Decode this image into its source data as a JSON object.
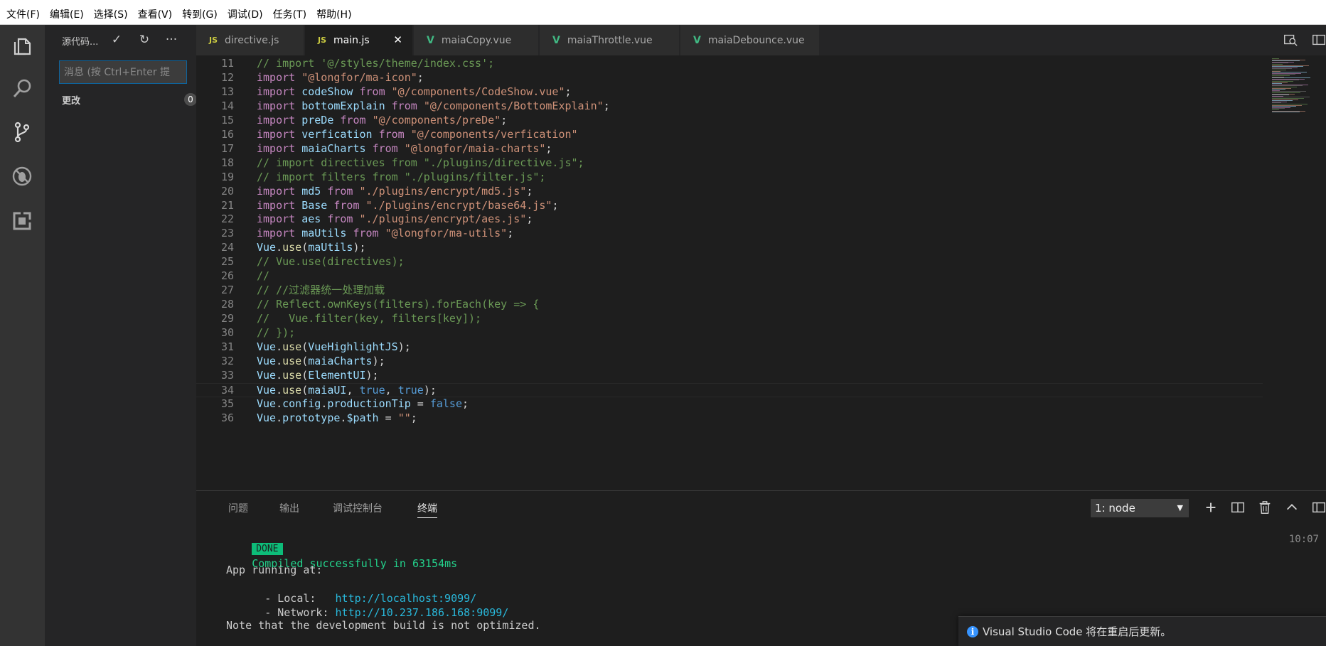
{
  "menubar": {
    "items": [
      "文件(F)",
      "编辑(E)",
      "选择(S)",
      "查看(V)",
      "转到(G)",
      "调试(D)",
      "任务(T)",
      "帮助(H)"
    ]
  },
  "activitybar": {
    "icons": [
      "explorer-icon",
      "search-icon",
      "source-control-icon",
      "debug-icon",
      "extensions-icon"
    ]
  },
  "sidebar": {
    "title": "源代码...",
    "commit_placeholder": "消息 (按 Ctrl+Enter 提",
    "changes_label": "更改",
    "changes_count": "0"
  },
  "tabs": [
    {
      "label": "directive.js",
      "type": "js",
      "icon_text": "JS",
      "active": false
    },
    {
      "label": "main.js",
      "type": "js",
      "icon_text": "JS",
      "active": true
    },
    {
      "label": "maiaCopy.vue",
      "type": "vue",
      "icon_text": "V",
      "active": false
    },
    {
      "label": "maiaThrottle.vue",
      "type": "vue",
      "icon_text": "V",
      "active": false
    },
    {
      "label": "maiaDebounce.vue",
      "type": "vue",
      "icon_text": "V",
      "active": false
    }
  ],
  "editor": {
    "lines": [
      {
        "n": "11",
        "tokens": [
          [
            "com",
            "// import '@/styles/theme/index.css';"
          ]
        ]
      },
      {
        "n": "12",
        "tokens": [
          [
            "kw",
            "import "
          ],
          [
            "str",
            "\"@longfor/ma-icon\""
          ],
          [
            "plain",
            ";"
          ]
        ]
      },
      {
        "n": "13",
        "tokens": [
          [
            "kw",
            "import "
          ],
          [
            "var",
            "codeShow "
          ],
          [
            "kw",
            "from "
          ],
          [
            "str",
            "\"@/components/CodeShow.vue\""
          ],
          [
            "plain",
            ";"
          ]
        ]
      },
      {
        "n": "14",
        "tokens": [
          [
            "kw",
            "import "
          ],
          [
            "var",
            "bottomExplain "
          ],
          [
            "kw",
            "from "
          ],
          [
            "str",
            "\"@/components/BottomExplain\""
          ],
          [
            "plain",
            ";"
          ]
        ]
      },
      {
        "n": "15",
        "tokens": [
          [
            "kw",
            "import "
          ],
          [
            "var",
            "preDe "
          ],
          [
            "kw",
            "from "
          ],
          [
            "str",
            "\"@/components/preDe\""
          ],
          [
            "plain",
            ";"
          ]
        ]
      },
      {
        "n": "16",
        "tokens": [
          [
            "kw",
            "import "
          ],
          [
            "var",
            "verfication "
          ],
          [
            "kw",
            "from "
          ],
          [
            "str",
            "\"@/components/verfication\""
          ]
        ]
      },
      {
        "n": "17",
        "tokens": [
          [
            "kw",
            "import "
          ],
          [
            "var",
            "maiaCharts "
          ],
          [
            "kw",
            "from "
          ],
          [
            "str",
            "\"@longfor/maia-charts\""
          ],
          [
            "plain",
            ";"
          ]
        ]
      },
      {
        "n": "18",
        "tokens": [
          [
            "com",
            "// import directives from \"./plugins/directive.js\";"
          ]
        ]
      },
      {
        "n": "19",
        "tokens": [
          [
            "com",
            "// import filters from \"./plugins/filter.js\";"
          ]
        ]
      },
      {
        "n": "20",
        "tokens": [
          [
            "kw",
            "import "
          ],
          [
            "var",
            "md5 "
          ],
          [
            "kw",
            "from "
          ],
          [
            "str",
            "\"./plugins/encrypt/md5.js\""
          ],
          [
            "plain",
            ";"
          ]
        ]
      },
      {
        "n": "21",
        "tokens": [
          [
            "kw",
            "import "
          ],
          [
            "var",
            "Base "
          ],
          [
            "kw",
            "from "
          ],
          [
            "str",
            "\"./plugins/encrypt/base64.js\""
          ],
          [
            "plain",
            ";"
          ]
        ]
      },
      {
        "n": "22",
        "tokens": [
          [
            "kw",
            "import "
          ],
          [
            "var",
            "aes "
          ],
          [
            "kw",
            "from "
          ],
          [
            "str",
            "\"./plugins/encrypt/aes.js\""
          ],
          [
            "plain",
            ";"
          ]
        ]
      },
      {
        "n": "23",
        "tokens": [
          [
            "kw",
            "import "
          ],
          [
            "var",
            "maUtils "
          ],
          [
            "kw",
            "from "
          ],
          [
            "str",
            "\"@longfor/ma-utils\""
          ],
          [
            "plain",
            ";"
          ]
        ]
      },
      {
        "n": "24",
        "tokens": [
          [
            "var",
            "Vue"
          ],
          [
            "plain",
            "."
          ],
          [
            "fn",
            "use"
          ],
          [
            "plain",
            "("
          ],
          [
            "var",
            "maUtils"
          ],
          [
            "plain",
            ");"
          ]
        ]
      },
      {
        "n": "25",
        "tokens": [
          [
            "com",
            "// Vue.use(directives);"
          ]
        ]
      },
      {
        "n": "26",
        "tokens": [
          [
            "com",
            "//"
          ]
        ]
      },
      {
        "n": "27",
        "tokens": [
          [
            "com",
            "// //过滤器统一处理加载"
          ]
        ]
      },
      {
        "n": "28",
        "tokens": [
          [
            "com",
            "// Reflect.ownKeys(filters).forEach(key => {"
          ]
        ]
      },
      {
        "n": "29",
        "tokens": [
          [
            "com",
            "//   Vue.filter(key, filters[key]);"
          ]
        ]
      },
      {
        "n": "30",
        "tokens": [
          [
            "com",
            "// });"
          ]
        ]
      },
      {
        "n": "31",
        "tokens": [
          [
            "var",
            "Vue"
          ],
          [
            "plain",
            "."
          ],
          [
            "fn",
            "use"
          ],
          [
            "plain",
            "("
          ],
          [
            "var",
            "VueHighlightJS"
          ],
          [
            "plain",
            ");"
          ]
        ]
      },
      {
        "n": "32",
        "tokens": [
          [
            "var",
            "Vue"
          ],
          [
            "plain",
            "."
          ],
          [
            "fn",
            "use"
          ],
          [
            "plain",
            "("
          ],
          [
            "var",
            "maiaCharts"
          ],
          [
            "plain",
            ");"
          ]
        ]
      },
      {
        "n": "33",
        "tokens": [
          [
            "var",
            "Vue"
          ],
          [
            "plain",
            "."
          ],
          [
            "fn",
            "use"
          ],
          [
            "plain",
            "("
          ],
          [
            "var",
            "ElementUI"
          ],
          [
            "plain",
            ");"
          ]
        ]
      },
      {
        "n": "34",
        "tokens": [
          [
            "var",
            "Vue"
          ],
          [
            "plain",
            "."
          ],
          [
            "fn",
            "use"
          ],
          [
            "plain",
            "("
          ],
          [
            "var",
            "maiaUI"
          ],
          [
            "plain",
            ", "
          ],
          [
            "bool",
            "true"
          ],
          [
            "plain",
            ", "
          ],
          [
            "bool",
            "true"
          ],
          [
            "plain",
            ");"
          ]
        ],
        "current": true
      },
      {
        "n": "35",
        "tokens": [
          [
            "var",
            "Vue"
          ],
          [
            "plain",
            "."
          ],
          [
            "var",
            "config"
          ],
          [
            "plain",
            "."
          ],
          [
            "var",
            "productionTip"
          ],
          [
            "plain",
            " = "
          ],
          [
            "bool",
            "false"
          ],
          [
            "plain",
            ";"
          ]
        ]
      },
      {
        "n": "36",
        "tokens": [
          [
            "var",
            "Vue"
          ],
          [
            "plain",
            "."
          ],
          [
            "var",
            "prototype"
          ],
          [
            "plain",
            "."
          ],
          [
            "var",
            "$path"
          ],
          [
            "plain",
            " = "
          ],
          [
            "str",
            "\"\""
          ],
          [
            "plain",
            ";"
          ]
        ]
      }
    ]
  },
  "panel": {
    "tabs": [
      "问题",
      "输出",
      "调试控制台",
      "终端"
    ],
    "active_tab": "终端",
    "terminal_select": "1: node",
    "terminal": {
      "done_badge": "DONE",
      "compiled_text": "Compiled successfully in 63154ms",
      "time": "10:07",
      "app_running": "App running at:",
      "local_label": "- Local:   ",
      "local_url": "http://localhost:9099/",
      "network_label": "- Network: ",
      "network_url": "http://10.237.186.168:9099/",
      "note": "Note that the development build is not optimized."
    }
  },
  "notification": {
    "text": "Visual Studio Code 将在重启后更新。"
  }
}
